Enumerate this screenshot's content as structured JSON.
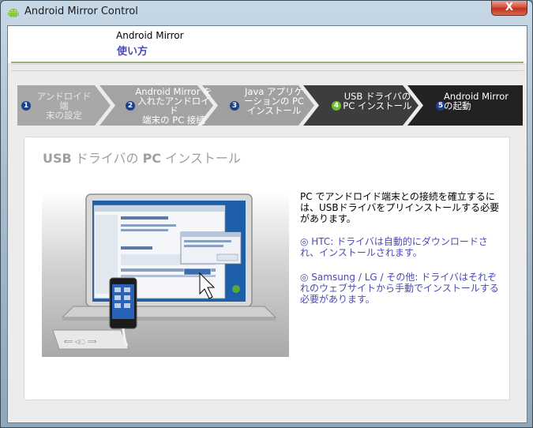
{
  "window": {
    "title": "Android Mirror Control",
    "close_label": "X"
  },
  "header": {
    "title": "Android Mirror",
    "subtitle": "使い方"
  },
  "steps": [
    {
      "number": "1",
      "label_lines": [
        "アンドロイド端",
        "末の設定"
      ],
      "state": "done"
    },
    {
      "number": "2",
      "label_lines": [
        "Android Mirror を",
        "入れたアンドロイド",
        "端末の PC 接続"
      ],
      "state": "done"
    },
    {
      "number": "3",
      "label_lines": [
        "Java アプリケ",
        "ーションの PC",
        "インストール"
      ],
      "state": "done"
    },
    {
      "number": "4",
      "label_lines": [
        "USB ドライバの",
        "PC インストール"
      ],
      "state": "current"
    },
    {
      "number": "5",
      "label_lines": [
        "Android Mirror",
        "の起動"
      ],
      "state": "upcoming"
    }
  ],
  "panel": {
    "heading_bold1": "USB",
    "heading_mid": " ドライバの ",
    "heading_bold2": "PC",
    "heading_end": " インストール",
    "intro": "PC でアンドロイド端末との接続を確立するには、USBドライバをプリインストールする必要があります。",
    "items": [
      "◎ HTC: ドライバは自動的にダウンロードされ、インストールされます。",
      "◎ Samsung / LG / その他: ドライバはそれぞれのウェブサイトから手動でインストールする必要があります。"
    ]
  },
  "colors": {
    "step_done": "#a6a6a6",
    "step_current": "#3a3a3a",
    "step_upcoming": "#1f1f1f",
    "accent_blue": "#4b4bb8",
    "step4_number": "#6bbf2a"
  }
}
